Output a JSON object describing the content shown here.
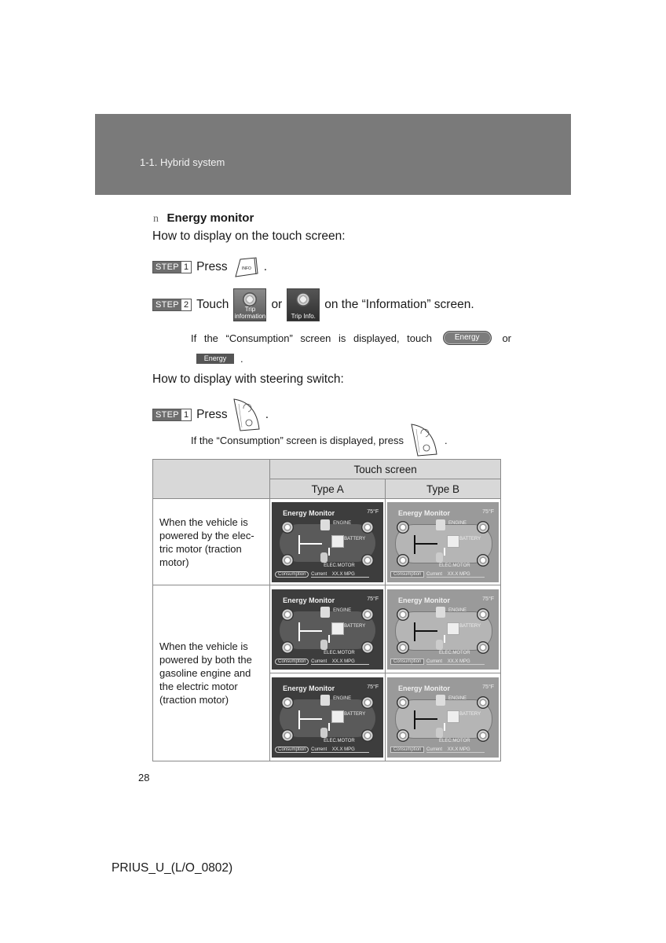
{
  "header": {
    "section": "1-1. Hybrid system"
  },
  "content": {
    "bullet_glyph": "n",
    "heading": "Energy monitor",
    "touch_intro": "How to display on the touch screen:",
    "touch_steps": [
      {
        "step_label": "STEP",
        "step_num": "1",
        "before": "Press",
        "icon": "info-key-icon",
        "icon_text": "INFO",
        "after": "."
      },
      {
        "step_label": "STEP",
        "step_num": "2",
        "before": "Touch",
        "icon_a_caption": "Trip information",
        "or": "or",
        "icon_b_caption": "Trip Info.",
        "after": "on the “Information” screen."
      }
    ],
    "touch_note": {
      "text": "If the “Consumption” screen is displayed, touch",
      "pill_button": "Energy",
      "or": "or",
      "rect_button": "Energy",
      "end": "."
    },
    "switch_intro": "How to display with steering switch:",
    "switch_steps": [
      {
        "step_label": "STEP",
        "step_num": "1",
        "before": "Press",
        "icon": "steering-switch-icon",
        "after": "."
      }
    ],
    "switch_note": {
      "text": "If the “Consumption” screen is displayed, press",
      "end": "."
    }
  },
  "table": {
    "header_group": "Touch screen",
    "columns": [
      "Type A",
      "Type B"
    ],
    "rows": [
      {
        "description": "When the vehicle is powered by the elec-tric motor (traction motor)"
      },
      {
        "description": "When the vehicle is powered by both the gasoline engine and the electric motor (traction motor)"
      }
    ],
    "screen": {
      "title": "Energy Monitor",
      "outside_temp": "75°F",
      "engine_label": "ENGINE",
      "battery_label": "BATTERY",
      "motor_label": "ELEC.MOTOR",
      "consumption_button": "Consumption",
      "current_label": "Current",
      "mpg_values": [
        "XX.X MPG",
        "XX.X MPG",
        "XX.X MPG"
      ]
    }
  },
  "footer": {
    "page_number": "28",
    "doc_code": "PRIUS_U_(L/O_0802)"
  }
}
